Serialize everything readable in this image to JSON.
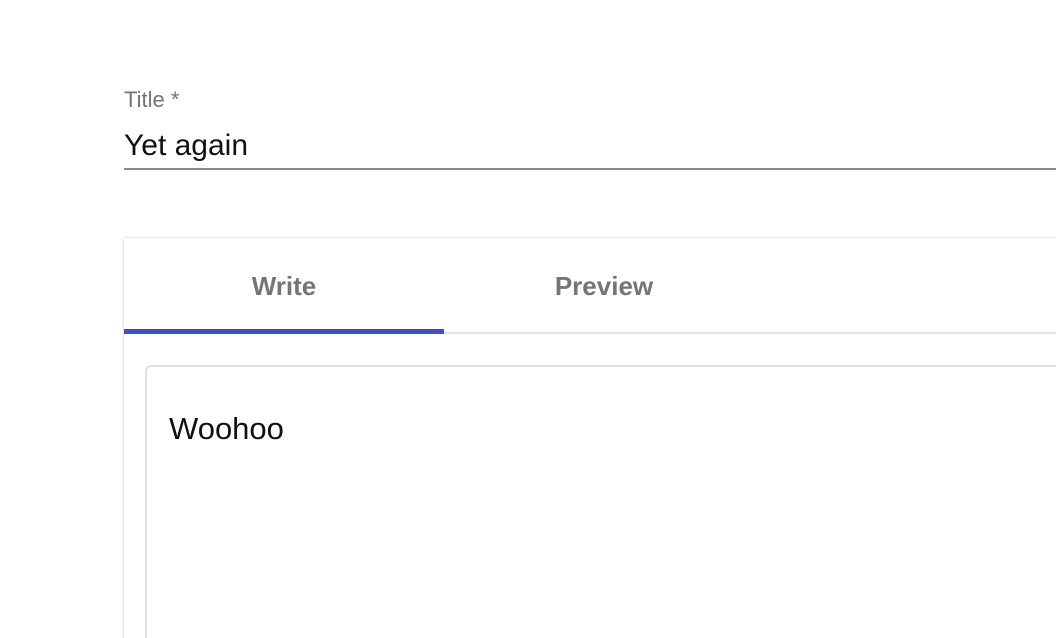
{
  "form": {
    "title_label": "Title *",
    "title_value": "Yet again"
  },
  "editor": {
    "tabs": [
      {
        "label": "Write",
        "active": true
      },
      {
        "label": "Preview",
        "active": false
      }
    ],
    "content": "Woohoo",
    "accent_color": "#3f51b5"
  }
}
